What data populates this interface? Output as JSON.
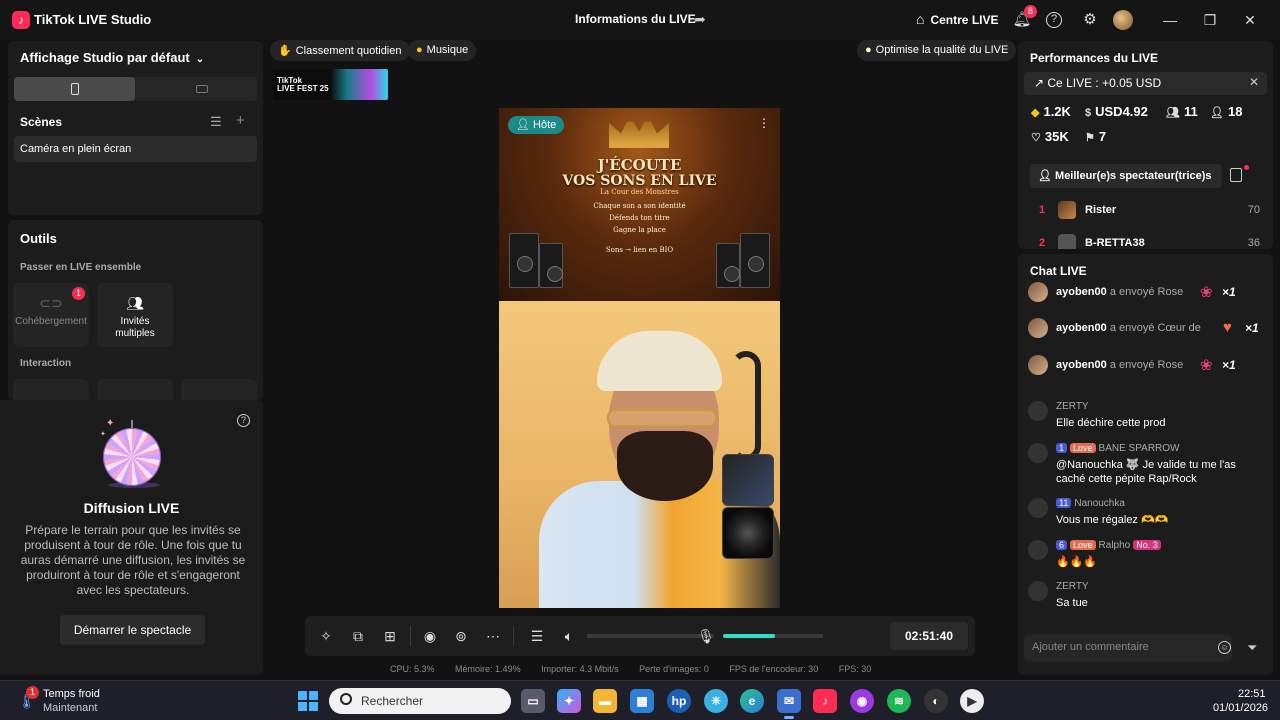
{
  "titlebar": {
    "app_title": "TikTok LIVE Studio",
    "center_title": "Informations du LIVE",
    "home_label": "Centre LIVE",
    "notif_count": "8"
  },
  "left": {
    "view_title": "Affichage Studio par défaut",
    "scenes_label": "Scènes",
    "scene_item": "Caméra en plein écran",
    "tools_label": "Outils",
    "together_label": "Passer en LIVE ensemble",
    "cohost_label": "Cohébergement",
    "cohost_badge": "1",
    "multi_guest_label": "Invités multiples",
    "interaction_label": "Interaction",
    "diffusion_title": "Diffusion LIVE",
    "diffusion_text": "Prépare le terrain pour que les invités se produisent à tour de rôle. Une fois que tu auras démarré une diffusion, les invités se produiront à tour de rôle et s'engageront avec les spectateurs.",
    "start_button": "Démarrer le spectacle"
  },
  "center": {
    "pill_ranking": "Classement quotidien",
    "pill_music": "Musique",
    "pill_quality": "Optimise la qualité du LIVE",
    "fest_label_1": "TikTok",
    "fest_label_2": "LIVE FEST 25",
    "host_tag": "Hôte",
    "banner": {
      "line1": "J'ÉCOUTE",
      "line2": "VOS SONS EN LIVE",
      "line3": "La Cour des Monstres",
      "item1": "Chaque son a son identité",
      "item2": "Défends ton titre",
      "item3": "Gagne la place",
      "item4": "Sons → lien en BIO"
    },
    "timer": "02:51:40",
    "mic_level": 0.52,
    "stats": {
      "cpu": "CPU:  5.3%",
      "mem": "Mémoire:  1.49%",
      "upload": "Importer:  4.3 Mbit/s",
      "frames": "Perte d'images:  0",
      "encoder": "FPS de l'encodeur:  30",
      "fps": "FPS:  30"
    }
  },
  "right": {
    "perf_title": "Performances du LIVE",
    "earnings": "Ce LIVE : +0.05 USD",
    "metrics": {
      "diamonds": "1.2K",
      "usd": "USD4.92",
      "viewers": "11",
      "followers": "18",
      "likes": "35K",
      "shares": "7"
    },
    "top_viewers_button": "Meilleur(e)s spectateur(trice)s",
    "ranking": [
      {
        "rank": "1",
        "name": "Rister",
        "score": "70"
      },
      {
        "rank": "2",
        "name": "B-RETTA38",
        "score": "36"
      }
    ],
    "chat_title": "Chat LIVE",
    "gifts": [
      {
        "user": "ayoben00",
        "action": "a envoyé Rose",
        "count": "×1"
      },
      {
        "user": "ayoben00",
        "action": "a envoyé Cœur de",
        "count": "×1"
      },
      {
        "user": "ayoben00",
        "action": "a envoyé Rose",
        "count": "×1"
      }
    ],
    "messages": [
      {
        "user": "ZERTY",
        "text": "Elle déchire cette prod"
      },
      {
        "user": "BANE SPARROW",
        "level": "1",
        "love": "Love",
        "text": "@Nanouchka 🐺 Je valide tu me l'as caché cette pépite Rap/Rock"
      },
      {
        "user": "Nanouchka",
        "level": "11",
        "text": "Vous me régalez 🫶🫶"
      },
      {
        "user": "Ralpho",
        "level": "6",
        "love": "Love",
        "rank": "No. 3",
        "text": "🔥🔥🔥"
      },
      {
        "user": "ZERTY",
        "text": "Sa tue"
      }
    ],
    "comment_placeholder": "Ajouter un commentaire"
  },
  "taskbar": {
    "weather_title": "Temps froid",
    "weather_sub": "Maintenant",
    "weather_badge": "1",
    "search_placeholder": "Rechercher",
    "time": "22:51",
    "date": "01/01/2026"
  },
  "colors": {
    "accent": "#fe2c55",
    "teal": "#2fe0c8",
    "host": "#1d8a8a"
  }
}
